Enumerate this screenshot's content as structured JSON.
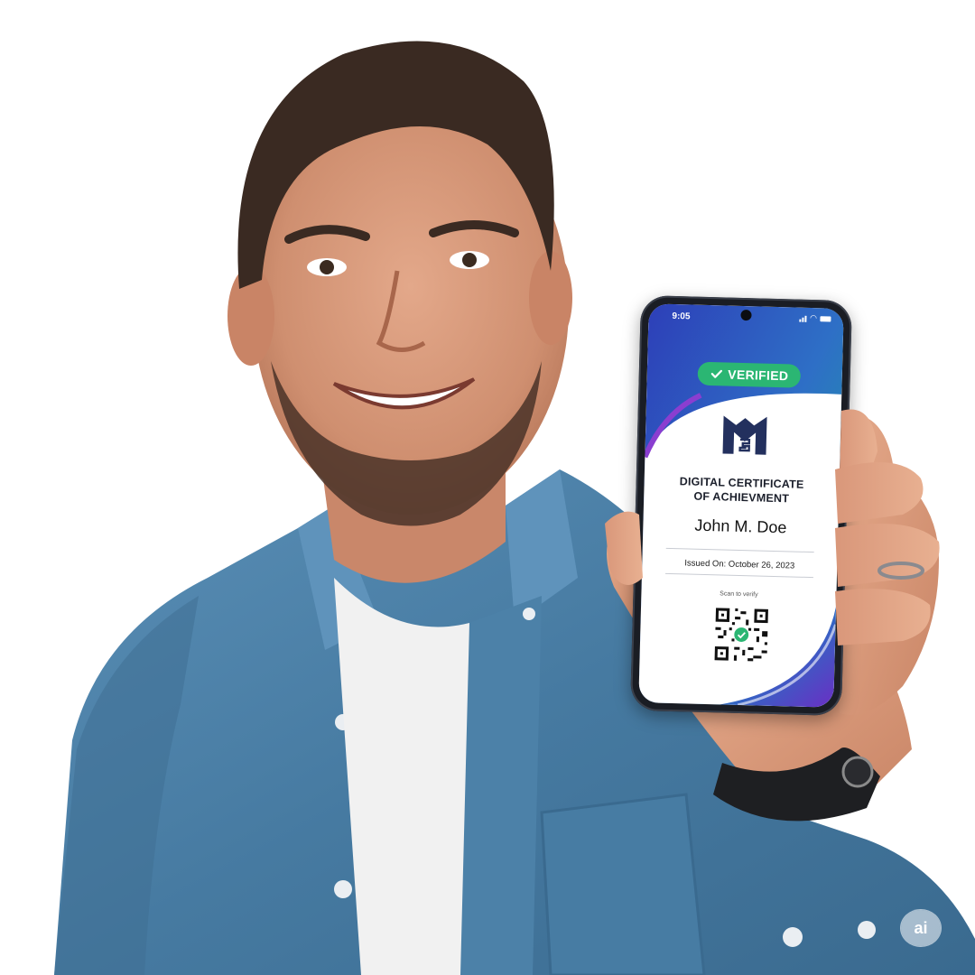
{
  "phone": {
    "status_time": "9:05",
    "badge": {
      "label": "VERIFIED",
      "color": "#2bb673"
    },
    "certificate": {
      "title_line1": "DIGITAL CERTIFICATE",
      "title_line2": "OF ACHIEVMENT",
      "recipient_name": "John M. Doe",
      "issued": "Issued On: October 26, 2023",
      "qr_caption": "Scan to verify"
    },
    "logo_icon": "monogram-logo-icon",
    "qr_icon": "qr-code-icon"
  },
  "scene": {
    "subject": "smiling man holding smartphone",
    "shirt_color": "#4a7da3",
    "tee_color": "#f2f2f2"
  },
  "watermark": {
    "label": "ai"
  }
}
